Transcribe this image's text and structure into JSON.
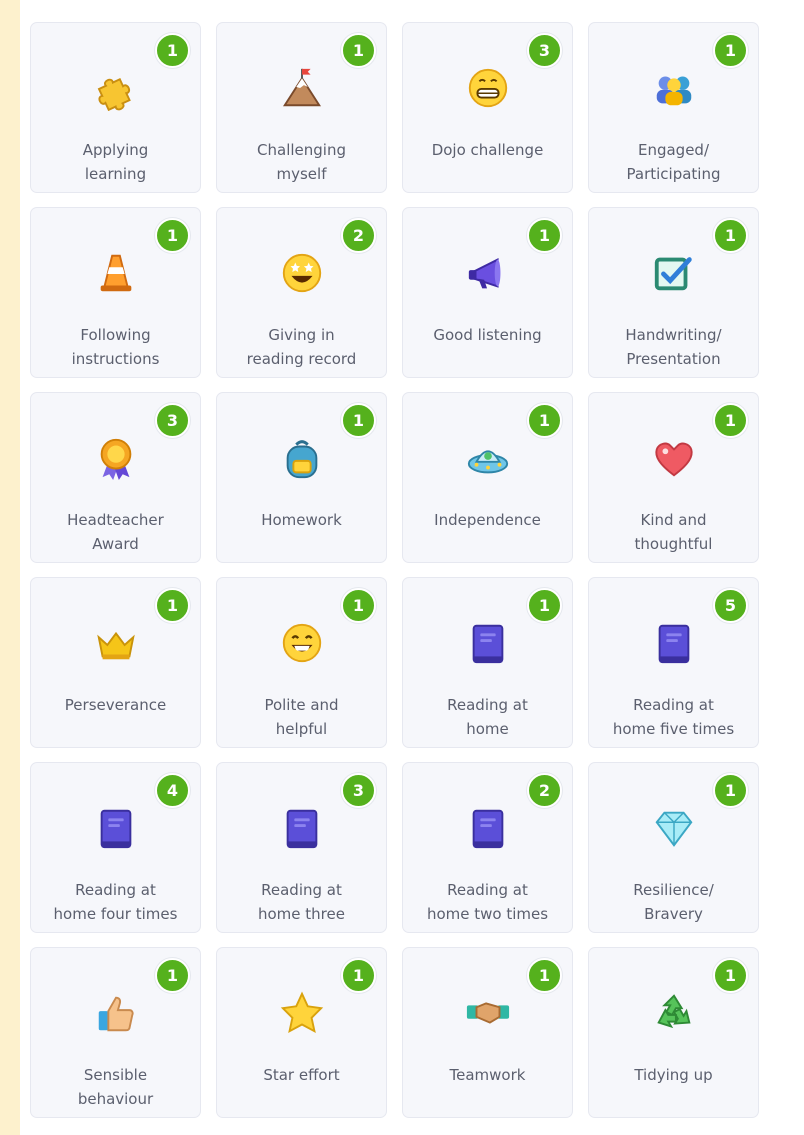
{
  "colors": {
    "page_background": "#fdf1cd",
    "card_background": "#f6f7fb",
    "badge": "#55b11d",
    "label_text": "#5b5f6e"
  },
  "skills": [
    {
      "label": "Applying\nlearning",
      "count": "1",
      "icon": "puzzle-icon"
    },
    {
      "label": "Challenging\nmyself",
      "count": "1",
      "icon": "mountain-flag-icon"
    },
    {
      "label": "Dojo challenge",
      "count": "3",
      "icon": "grimace-face-icon"
    },
    {
      "label": "Engaged/\nParticipating",
      "count": "1",
      "icon": "people-icon"
    },
    {
      "label": "Following\ninstructions",
      "count": "1",
      "icon": "traffic-cone-icon"
    },
    {
      "label": "Giving in\nreading record",
      "count": "2",
      "icon": "star-eyes-face-icon"
    },
    {
      "label": "Good listening",
      "count": "1",
      "icon": "megaphone-icon"
    },
    {
      "label": "Handwriting/\nPresentation",
      "count": "1",
      "icon": "checkbox-icon"
    },
    {
      "label": "Headteacher\nAward",
      "count": "3",
      "icon": "award-rosette-icon"
    },
    {
      "label": "Homework",
      "count": "1",
      "icon": "backpack-icon"
    },
    {
      "label": "Independence",
      "count": "1",
      "icon": "ufo-icon"
    },
    {
      "label": "Kind and\nthoughtful",
      "count": "1",
      "icon": "heart-icon"
    },
    {
      "label": "Perseverance",
      "count": "1",
      "icon": "crown-icon"
    },
    {
      "label": "Polite and\nhelpful",
      "count": "1",
      "icon": "laughing-face-icon"
    },
    {
      "label": "Reading at\nhome",
      "count": "1",
      "icon": "book-icon"
    },
    {
      "label": "Reading at\nhome five times",
      "count": "5",
      "icon": "book-icon"
    },
    {
      "label": "Reading at\nhome four times",
      "count": "4",
      "icon": "book-icon"
    },
    {
      "label": "Reading at\nhome three",
      "count": "3",
      "icon": "book-icon"
    },
    {
      "label": "Reading at\nhome two times",
      "count": "2",
      "icon": "book-icon"
    },
    {
      "label": "Resilience/\nBravery",
      "count": "1",
      "icon": "diamond-icon"
    },
    {
      "label": "Sensible\nbehaviour",
      "count": "1",
      "icon": "thumbs-up-icon"
    },
    {
      "label": "Star effort",
      "count": "1",
      "icon": "star-icon"
    },
    {
      "label": "Teamwork",
      "count": "1",
      "icon": "handshake-icon"
    },
    {
      "label": "Tidying up",
      "count": "1",
      "icon": "recycle-icon"
    }
  ]
}
